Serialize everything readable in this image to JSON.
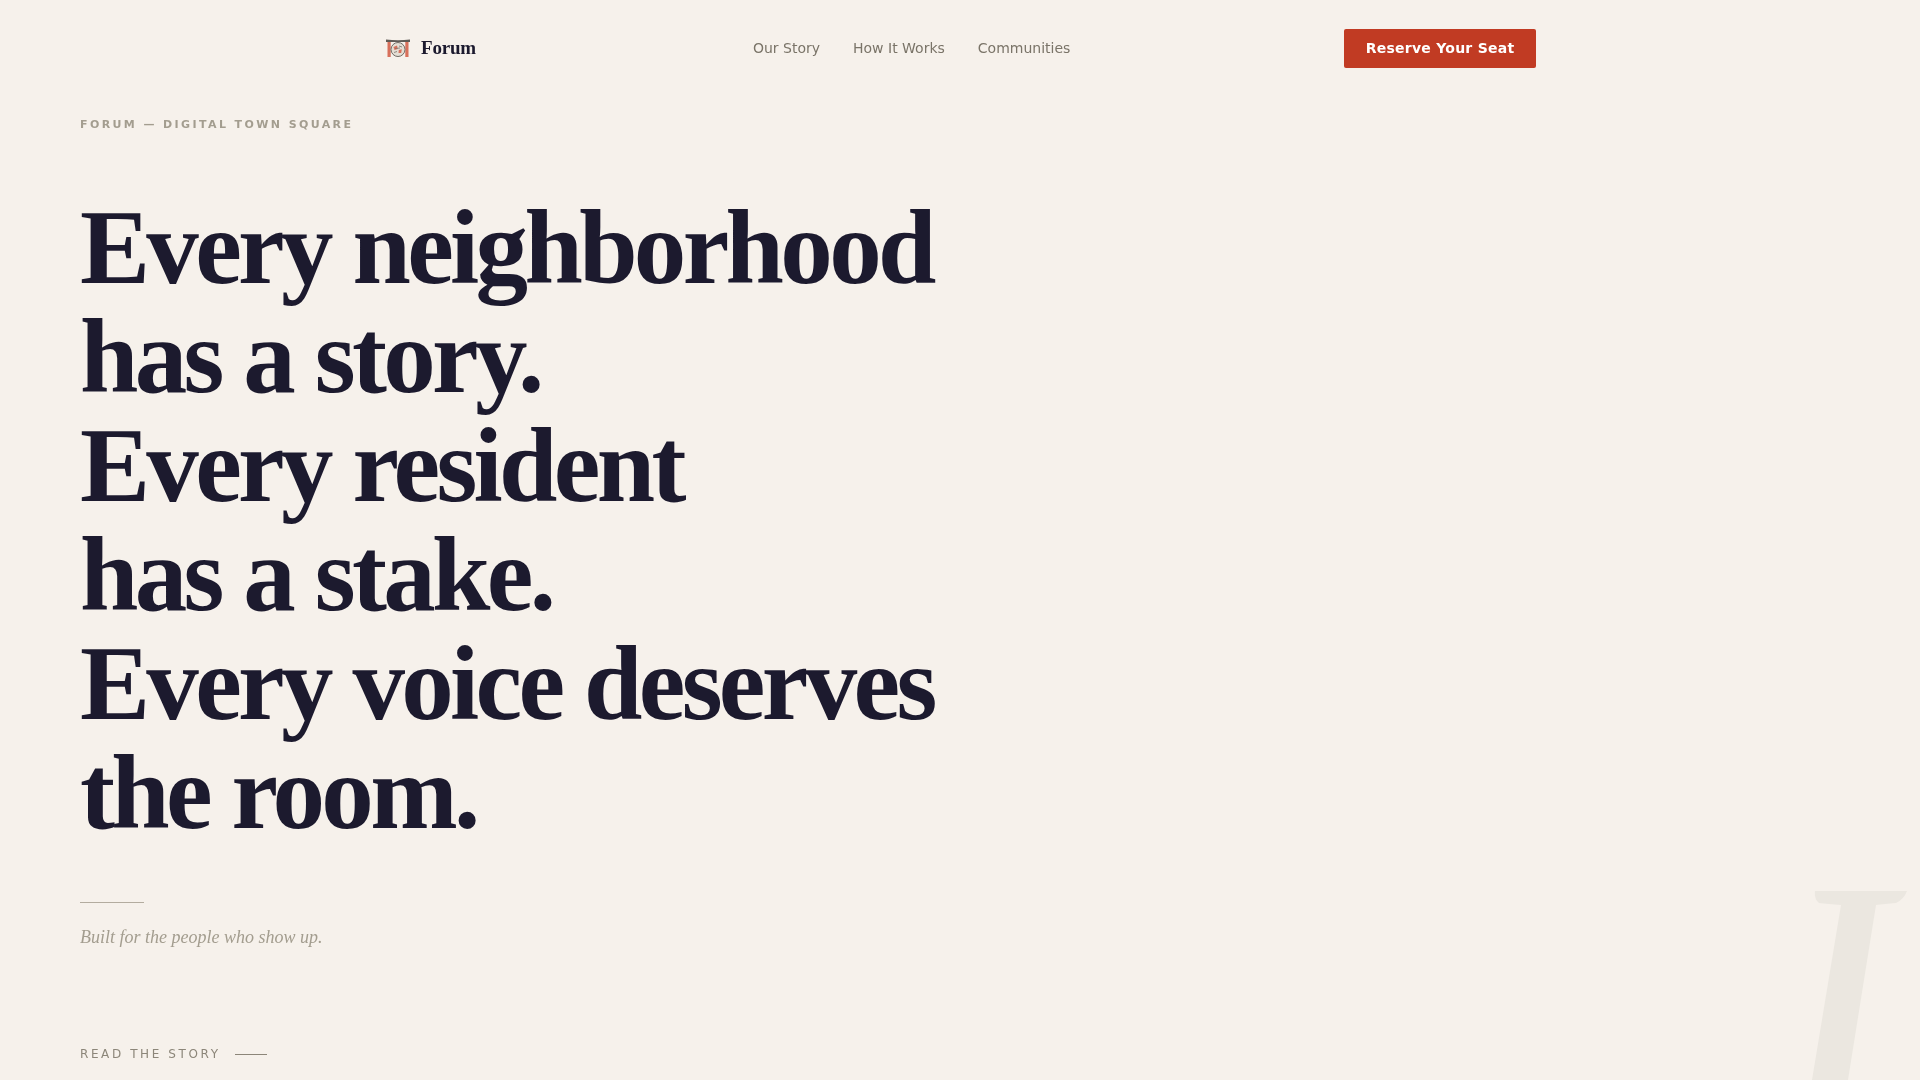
{
  "nav": {
    "brand": "Forum",
    "links": [
      "Our Story",
      "How It Works",
      "Communities"
    ],
    "cta": "Reserve Your Seat"
  },
  "hero": {
    "eyebrow": "FORUM — DIGITAL TOWN SQUARE",
    "headline": [
      "Every neighborhood",
      "has a story.",
      "Every resident",
      "has a stake.",
      "Every voice deserves",
      "the room."
    ],
    "tagline": "Built for the people who show up.",
    "read_more": "READ THE STORY"
  }
}
